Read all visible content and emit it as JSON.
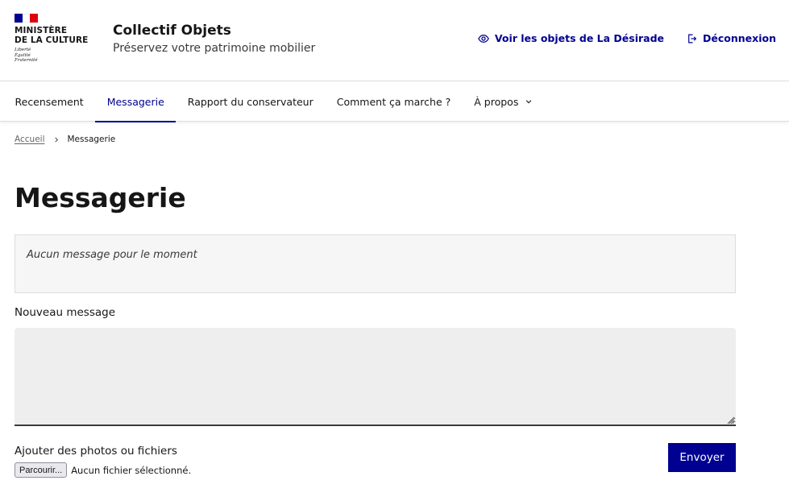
{
  "header": {
    "ministry_line1": "Ministère",
    "ministry_line2": "de la Culture",
    "motto_1": "Liberté",
    "motto_2": "Égalité",
    "motto_3": "Fraternité",
    "service_title": "Collectif Objets",
    "service_tagline": "Préservez votre patrimoine mobilier",
    "tools": {
      "view_objects_label": "Voir les objets de La Désirade",
      "logout_label": "Déconnexion"
    },
    "colors": {
      "brand_blue": "#000091",
      "flag_red": "#e1000f"
    }
  },
  "nav": {
    "items": [
      {
        "label": "Recensement"
      },
      {
        "label": "Messagerie"
      },
      {
        "label": "Rapport du conservateur"
      },
      {
        "label": "Comment ça marche ?"
      },
      {
        "label": "À propos"
      }
    ]
  },
  "breadcrumb": {
    "home": "Accueil",
    "current": "Messagerie"
  },
  "page": {
    "title": "Messagerie",
    "empty_messages": "Aucun message pour le moment",
    "new_message_label": "Nouveau message",
    "new_message_value": "",
    "attach_label": "Ajouter des photos ou fichiers",
    "file_button": "Parcourir...",
    "file_status": "Aucun fichier sélectionné.",
    "send_label": "Envoyer"
  }
}
